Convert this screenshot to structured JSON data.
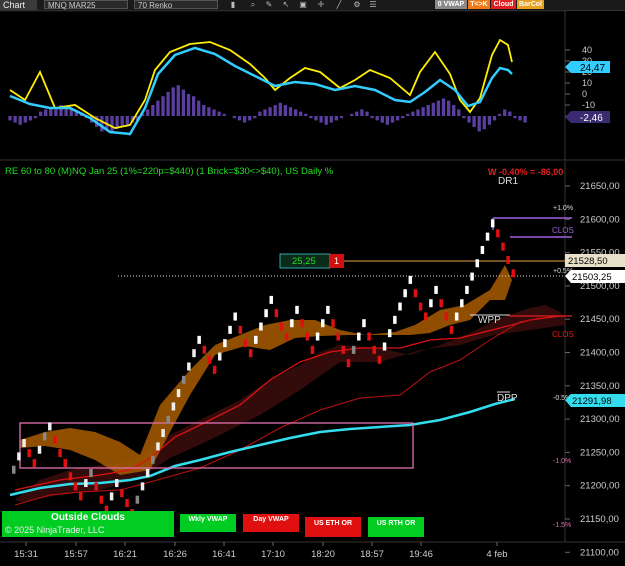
{
  "toolbar": {
    "chart_label": "Chart",
    "instrument": "MNQ MAR25",
    "bar_type": "70 Renko",
    "badges": [
      "0 VWAP",
      "T<>K",
      "Cloud",
      "BarCol"
    ],
    "badge_colors": [
      "#8a8a8a",
      "#f07a1a",
      "#e02020",
      "#e8a020"
    ]
  },
  "oscillator": {
    "ticks": [
      "40",
      "30",
      "20",
      "10",
      "0",
      "-10",
      "-20"
    ],
    "value_fast": "24,47",
    "value_hist": "-2,46",
    "fast_color": "#33ccff",
    "slow_color": "#ffee00",
    "hist_color": "#5a3fa0"
  },
  "main": {
    "info_label": "RE 60 to 80 (M)NQ Jan 25 (1%=220p=$440) (1 Brick=$30<>$40), US Daily %",
    "pnl_label": "W -0.40% = -86,00",
    "dr1_label": "DR1",
    "wpp_label": "WPP",
    "dpp_label": "DPP",
    "pct_labels": [
      "+1.0%",
      "+0.5%",
      "-0.5%",
      "-1.0%",
      "-1.5%"
    ],
    "clos_labels": [
      "CLOS",
      "CLOS"
    ],
    "position_box": {
      "value": "25,25",
      "qty": "1"
    },
    "price_ticks": [
      "21650,00",
      "21600,00",
      "21550,00",
      "21500,00",
      "21450,00",
      "21400,00",
      "21350,00",
      "21300,00",
      "21250,00",
      "21200,00",
      "21150,00",
      "21100,00"
    ],
    "price_markers": {
      "orange": "21528,50",
      "current": "21503,25",
      "cyan": "21291,98"
    }
  },
  "bottom_buttons": {
    "outside_clouds": "Outside Clouds",
    "copyright": "© 2025 NinjaTrader, LLC",
    "wkly_vwap": "Wkly VWAP",
    "day_vwap": "Day VWAP",
    "us_eth_or": "US ETH OR",
    "us_rth_or": "US RTH OR"
  },
  "time_axis": [
    "15:31",
    "15:57",
    "16:21",
    "16:26",
    "16:41",
    "17:10",
    "18:20",
    "18:57",
    "19:46",
    "4 feb"
  ]
}
